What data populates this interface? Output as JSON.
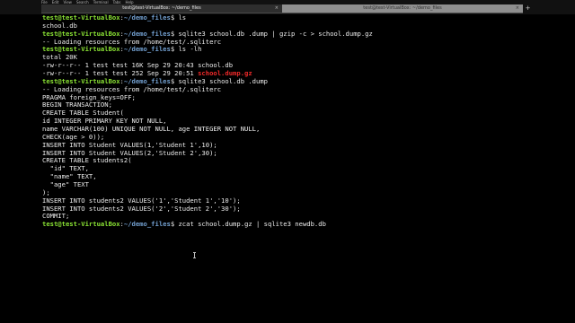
{
  "menu": [
    "File",
    "Edit",
    "View",
    "Search",
    "Terminal",
    "Tabs",
    "Help"
  ],
  "tabs": [
    {
      "title": "test@test-VirtualBox: ~/demo_files",
      "active": true
    },
    {
      "title": "test@test-VirtualBox: ~/demo_files",
      "active": false
    }
  ],
  "tab_close_glyph": "×",
  "new_tab_glyph": "+",
  "prompt": {
    "user": "test@test-VirtualBox",
    "separator": ":",
    "path": "~/demo_files",
    "symbol": "$ "
  },
  "lines": [
    {
      "kind": "cmd",
      "text": "ls"
    },
    {
      "kind": "out",
      "text": "school.db"
    },
    {
      "kind": "cmd",
      "text": "sqlite3 school.db .dump | gzip -c > school.dump.gz"
    },
    {
      "kind": "out",
      "text": "-- Loading resources from /home/test/.sqliterc"
    },
    {
      "kind": "cmd",
      "text": "ls -lh"
    },
    {
      "kind": "out",
      "text": "total 20K"
    },
    {
      "kind": "out",
      "text": "-rw-r--r-- 1 test test 16K Sep 29 20:43 school.db"
    },
    {
      "kind": "out_hl",
      "text": "-rw-r--r-- 1 test test 252 Sep 29 20:51 ",
      "hl": "school.dump.gz"
    },
    {
      "kind": "cmd",
      "text": "sqlite3 school.db .dump"
    },
    {
      "kind": "out",
      "text": "-- Loading resources from /home/test/.sqliterc"
    },
    {
      "kind": "out",
      "text": "PRAGMA foreign_keys=OFF;"
    },
    {
      "kind": "out",
      "text": "BEGIN TRANSACTION;"
    },
    {
      "kind": "out",
      "text": "CREATE TABLE Student("
    },
    {
      "kind": "out",
      "text": "id INTEGER PRIMARY KEY NOT NULL,"
    },
    {
      "kind": "out",
      "text": "name VARCHAR(100) UNIQUE NOT NULL, age INTEGER NOT NULL,"
    },
    {
      "kind": "out",
      "text": "CHECK(age > 0));"
    },
    {
      "kind": "out",
      "text": "INSERT INTO Student VALUES(1,'Student 1',10);"
    },
    {
      "kind": "out",
      "text": "INSERT INTO Student VALUES(2,'Student 2',30);"
    },
    {
      "kind": "out",
      "text": "CREATE TABLE students2("
    },
    {
      "kind": "out",
      "text": "  \"id\" TEXT,"
    },
    {
      "kind": "out",
      "text": "  \"name\" TEXT,"
    },
    {
      "kind": "out",
      "text": "  \"age\" TEXT"
    },
    {
      "kind": "out",
      "text": ");"
    },
    {
      "kind": "out",
      "text": "INSERT INTO students2 VALUES('1','Student 1','10');"
    },
    {
      "kind": "out",
      "text": "INSERT INTO students2 VALUES('2','Student 2','30');"
    },
    {
      "kind": "out",
      "text": "COMMIT;"
    },
    {
      "kind": "cmd",
      "text": "zcat school.dump.gz | sqlite3 newdb.db"
    }
  ],
  "colors": {
    "background": "#000000",
    "foreground": "#ececec",
    "prompt_user": "#8ae234",
    "prompt_path": "#729fcf",
    "archive_file": "#ef2929",
    "tab_active": "#2e2e2e",
    "tab_inactive": "#8f8f8f"
  }
}
